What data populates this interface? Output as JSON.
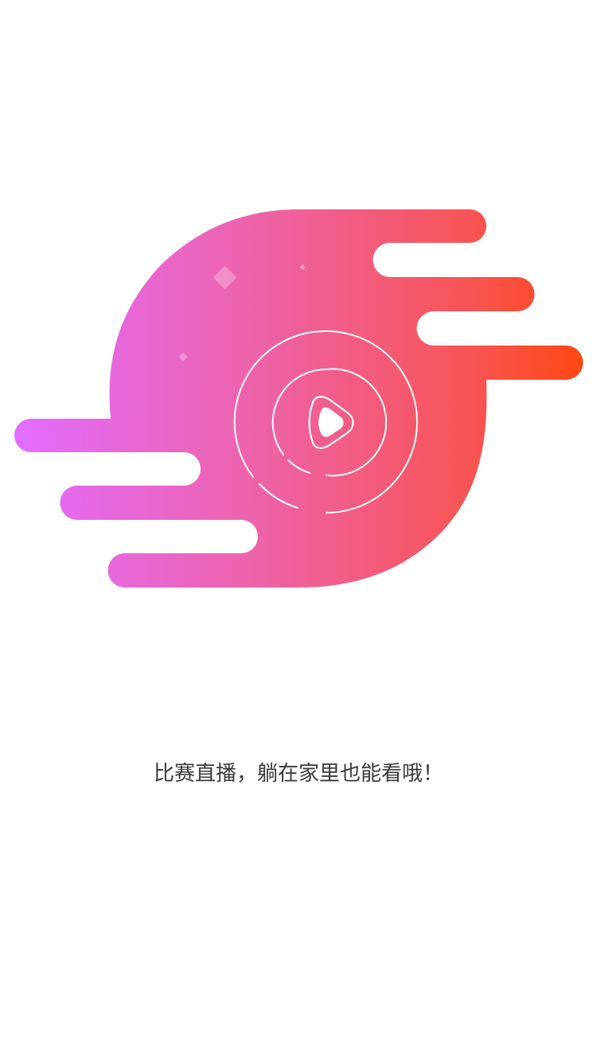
{
  "screen": {
    "background": "#ffffff"
  },
  "illustration": {
    "icon": "live-stream-play-icon",
    "gradient_start": "#e26cff",
    "gradient_mid": "#f06496",
    "gradient_end": "#ff4712"
  },
  "caption": {
    "text": "比赛直播，躺在家里也能看哦！",
    "color": "#3a3a3a"
  }
}
